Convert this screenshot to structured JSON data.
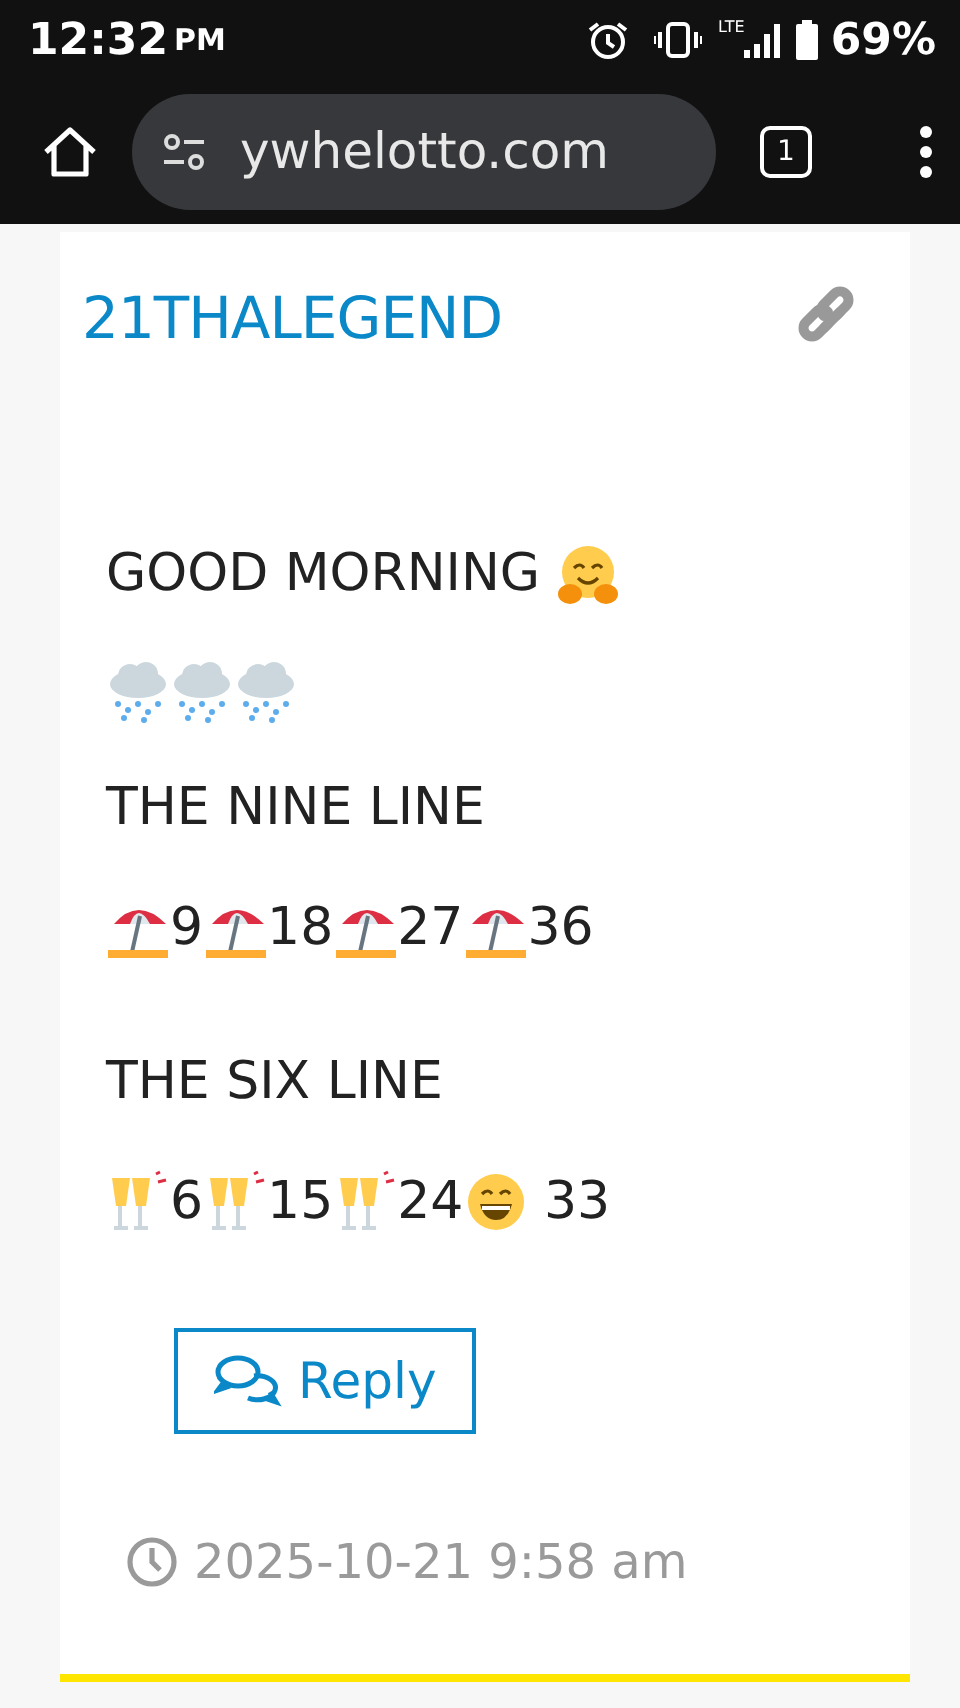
{
  "status_bar": {
    "time": "12:32",
    "ampm": "PM",
    "network": "LTE",
    "battery": "69%"
  },
  "browser": {
    "url": "ywhelotto.com",
    "tab_count": "1"
  },
  "comment": {
    "author": "21THALEGEND",
    "paragraphs": [
      {
        "lines": [
          {
            "segments": [
              {
                "kind": "text",
                "text": "GOOD MORNING "
              },
              {
                "kind": "hug"
              }
            ]
          },
          {
            "segments": [
              {
                "kind": "rain"
              },
              {
                "kind": "rain"
              },
              {
                "kind": "rain"
              }
            ]
          },
          {
            "segments": [
              {
                "kind": "text",
                "text": "THE NINE LINE"
              }
            ]
          },
          {
            "segments": [
              {
                "kind": "beach"
              },
              {
                "kind": "text",
                "text": "9"
              },
              {
                "kind": "beach"
              },
              {
                "kind": "text",
                "text": "18"
              },
              {
                "kind": "beach"
              },
              {
                "kind": "text",
                "text": "27"
              },
              {
                "kind": "beach"
              },
              {
                "kind": "text",
                "text": "36"
              }
            ]
          }
        ]
      },
      {
        "lines": [
          {
            "segments": [
              {
                "kind": "text",
                "text": "THE SIX LINE"
              }
            ]
          },
          {
            "segments": [
              {
                "kind": "cheers"
              },
              {
                "kind": "text",
                "text": "6"
              },
              {
                "kind": "cheers"
              },
              {
                "kind": "text",
                "text": "15"
              },
              {
                "kind": "cheers"
              },
              {
                "kind": "text",
                "text": "24"
              },
              {
                "kind": "grin"
              },
              {
                "kind": "text",
                "text": " 33"
              }
            ]
          }
        ]
      }
    ],
    "reply_label": "Reply",
    "date": "2025-10-21 9:58 am"
  }
}
